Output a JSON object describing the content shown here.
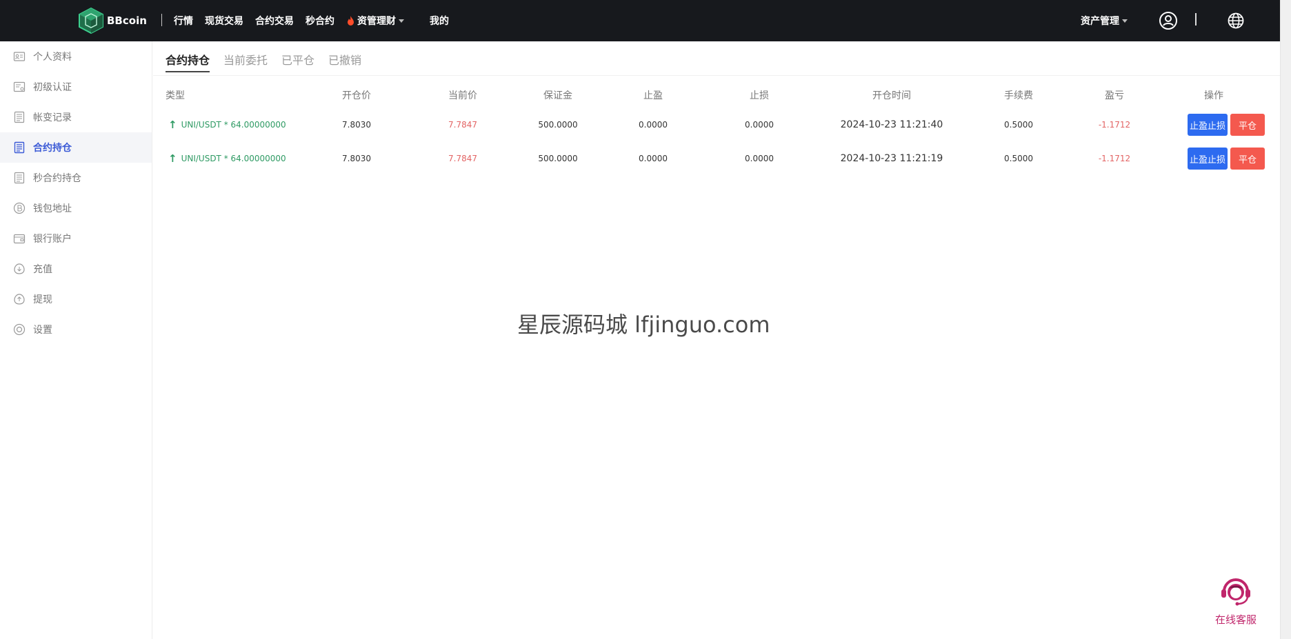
{
  "brand": {
    "name": "BBcoin",
    "logo_color": "#2fa36f"
  },
  "nav": {
    "items": [
      "行情",
      "现货交易",
      "合约交易",
      "秒合约"
    ],
    "wealth_label": "资管理财",
    "mine_label": "我的",
    "asset_label": "资产管理"
  },
  "sidebar": {
    "items": [
      {
        "label": "个人资料",
        "icon": "id-card-icon"
      },
      {
        "label": "初级认证",
        "icon": "certificate-icon"
      },
      {
        "label": "帐变记录",
        "icon": "list-icon"
      },
      {
        "label": "合约持仓",
        "icon": "list-icon",
        "active": true
      },
      {
        "label": "秒合约持仓",
        "icon": "list-icon"
      },
      {
        "label": "钱包地址",
        "icon": "bitcoin-icon"
      },
      {
        "label": "银行账户",
        "icon": "wallet-icon"
      },
      {
        "label": "充值",
        "icon": "deposit-icon"
      },
      {
        "label": "提现",
        "icon": "withdraw-icon"
      },
      {
        "label": "设置",
        "icon": "settings-icon"
      }
    ],
    "active_color": "#3b5ad6"
  },
  "tabs": [
    "合约持仓",
    "当前委托",
    "已平仓",
    "已撤销"
  ],
  "table": {
    "headers": [
      "类型",
      "开仓价",
      "当前价",
      "保证金",
      "止盈",
      "止损",
      "开仓时间",
      "手续费",
      "盈亏",
      "操作"
    ],
    "rows": [
      {
        "type": "UNI/USDT * 64.00000000",
        "open_price": "7.8030",
        "current_price": "7.7847",
        "margin": "500.0000",
        "take_profit": "0.0000",
        "stop_loss": "0.0000",
        "open_time": "2024-10-23  11:21:40",
        "fee": "0.5000",
        "pnl": "-1.1712",
        "btn_tpsl": "止盈止损",
        "btn_close": "平仓"
      },
      {
        "type": "UNI/USDT * 64.00000000",
        "open_price": "7.8030",
        "current_price": "7.7847",
        "margin": "500.0000",
        "take_profit": "0.0000",
        "stop_loss": "0.0000",
        "open_time": "2024-10-23  11:21:19",
        "fee": "0.5000",
        "pnl": "-1.1712",
        "btn_tpsl": "止盈止损",
        "btn_close": "平仓"
      }
    ]
  },
  "watermark": "星辰源码城  lfjinguo.com",
  "service": {
    "label": "在线客服",
    "color": "#c0266b"
  }
}
